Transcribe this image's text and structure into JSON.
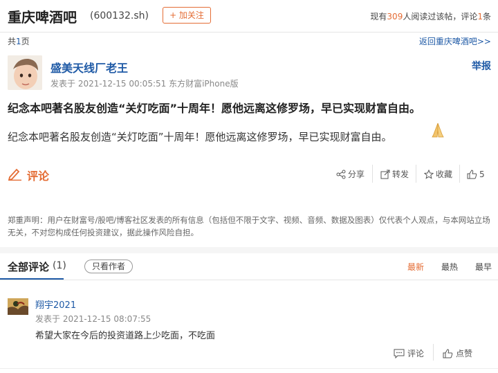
{
  "header": {
    "bar_name": "重庆啤酒吧",
    "stock_code": "(600132.sh)",
    "follow_label": "+ 加关注",
    "readers_prefix": "现有",
    "readers_count": "309",
    "readers_mid": "人阅读过该帖，评论",
    "comments_count": "1",
    "readers_suffix": "条"
  },
  "pager": {
    "prefix": "共",
    "pages": "1",
    "suffix": "页",
    "back_link": "返回重庆啤酒吧>>"
  },
  "post": {
    "author": "盛美天线厂老王",
    "report_label": "举报",
    "meta": "发表于 2021-12-15 00:05:51 东方财富iPhone版",
    "title": "纪念本吧著名股友创造“关灯吃面”十周年！愿他远离这修罗场，早已实现财富自由。",
    "body": "纪念本吧著名股友创造“关灯吃面”十周年！愿他远离这修罗场，早已实现财富自由。",
    "emoji_icon": "praying-hands-icon"
  },
  "actions": {
    "comment_label": "评论",
    "share_label": "分享",
    "repost_label": "转发",
    "favorite_label": "收藏",
    "like_count": "5"
  },
  "disclaimer": "郑重声明：用户在财富号/股吧/博客社区发表的所有信息（包括但不限于文字、视频、音频、数据及图表）仅代表个人观点，与本网站立场无关，不对您构成任何投资建议，据此操作风险自担。",
  "comments_section": {
    "title": "全部评论",
    "count": "(1)",
    "only_author_label": "只看作者",
    "sort_options": [
      "最新",
      "最热",
      "最早"
    ],
    "active_sort": "最新",
    "items": [
      {
        "user": "翔宇2021",
        "meta": "发表于 2021-12-15 08:07:55",
        "text": "希望大家在今后的投资道路上少吃面，不吃面",
        "comment_label": "评论",
        "like_label": "点赞"
      }
    ]
  },
  "colors": {
    "accent": "#e46c34",
    "link": "#1f5aa6"
  }
}
